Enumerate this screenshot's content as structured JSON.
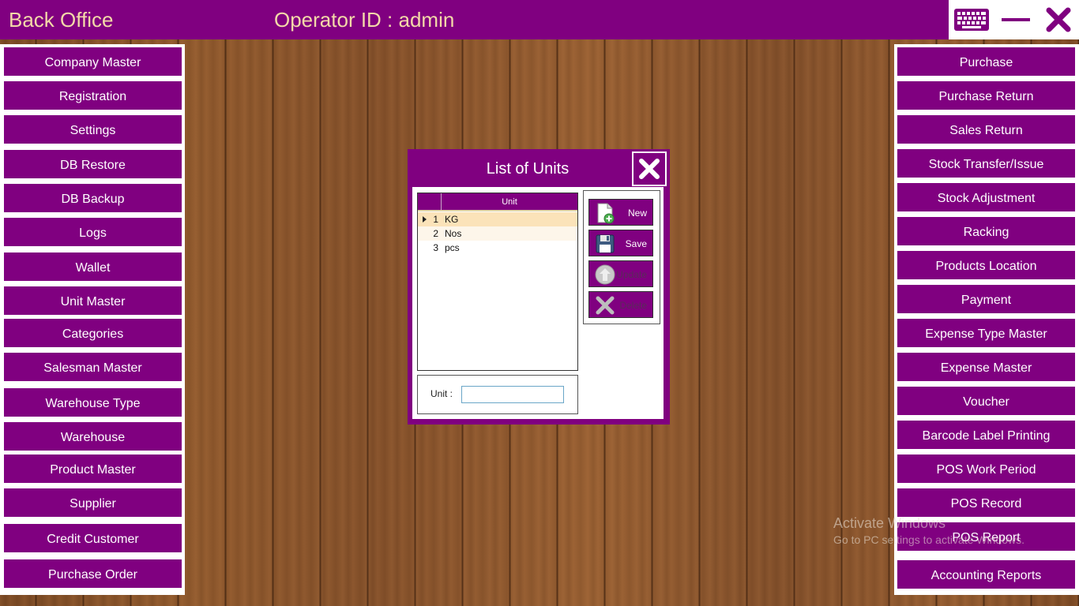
{
  "window": {
    "app_title": "Back Office",
    "operator_text": "Operator ID :  admin"
  },
  "left_menu": [
    {
      "label": "Company Master"
    },
    {
      "label": "Registration"
    },
    {
      "label": "Settings"
    },
    {
      "label": "DB Restore"
    },
    {
      "label": "DB Backup"
    },
    {
      "label": "Logs"
    },
    {
      "label": "Wallet"
    },
    {
      "label": "Unit Master"
    },
    {
      "label": "Categories"
    },
    {
      "label": "Salesman Master"
    },
    {
      "label": "Warehouse Type"
    },
    {
      "label": "Warehouse"
    },
    {
      "label": "Product Master"
    },
    {
      "label": "Supplier"
    },
    {
      "label": "Credit Customer"
    },
    {
      "label": "Purchase Order"
    }
  ],
  "right_menu": [
    {
      "label": "Purchase"
    },
    {
      "label": "Purchase Return"
    },
    {
      "label": "Sales Return"
    },
    {
      "label": "Stock Transfer/Issue"
    },
    {
      "label": "Stock Adjustment"
    },
    {
      "label": "Racking"
    },
    {
      "label": "Products Location"
    },
    {
      "label": "Payment"
    },
    {
      "label": "Expense Type Master"
    },
    {
      "label": "Expense Master"
    },
    {
      "label": "Voucher"
    },
    {
      "label": "Barcode Label Printing"
    },
    {
      "label": "POS Work Period"
    },
    {
      "label": "POS Record"
    },
    {
      "label": "POS Report"
    },
    {
      "label": "Accounting Reports"
    }
  ],
  "dialog": {
    "title": "List of Units",
    "grid": {
      "column_header": "Unit",
      "rows": [
        {
          "num": "1",
          "value": "KG",
          "selected": true
        },
        {
          "num": "2",
          "value": "Nos",
          "selected": false
        },
        {
          "num": "3",
          "value": "pcs",
          "selected": false
        }
      ]
    },
    "actions": {
      "new_label": "New",
      "save_label": "Save",
      "update_label": "Update",
      "delete_label": "Delete"
    },
    "unit_field": {
      "label": "Unit :",
      "value": ""
    }
  },
  "watermark": {
    "title": "Activate Windows",
    "subtitle": "Go to PC settings to activate Windows."
  },
  "colors": {
    "brand_purple": "#800080",
    "title_text": "#f3d9a8",
    "selected_row": "#fbe3b9"
  }
}
